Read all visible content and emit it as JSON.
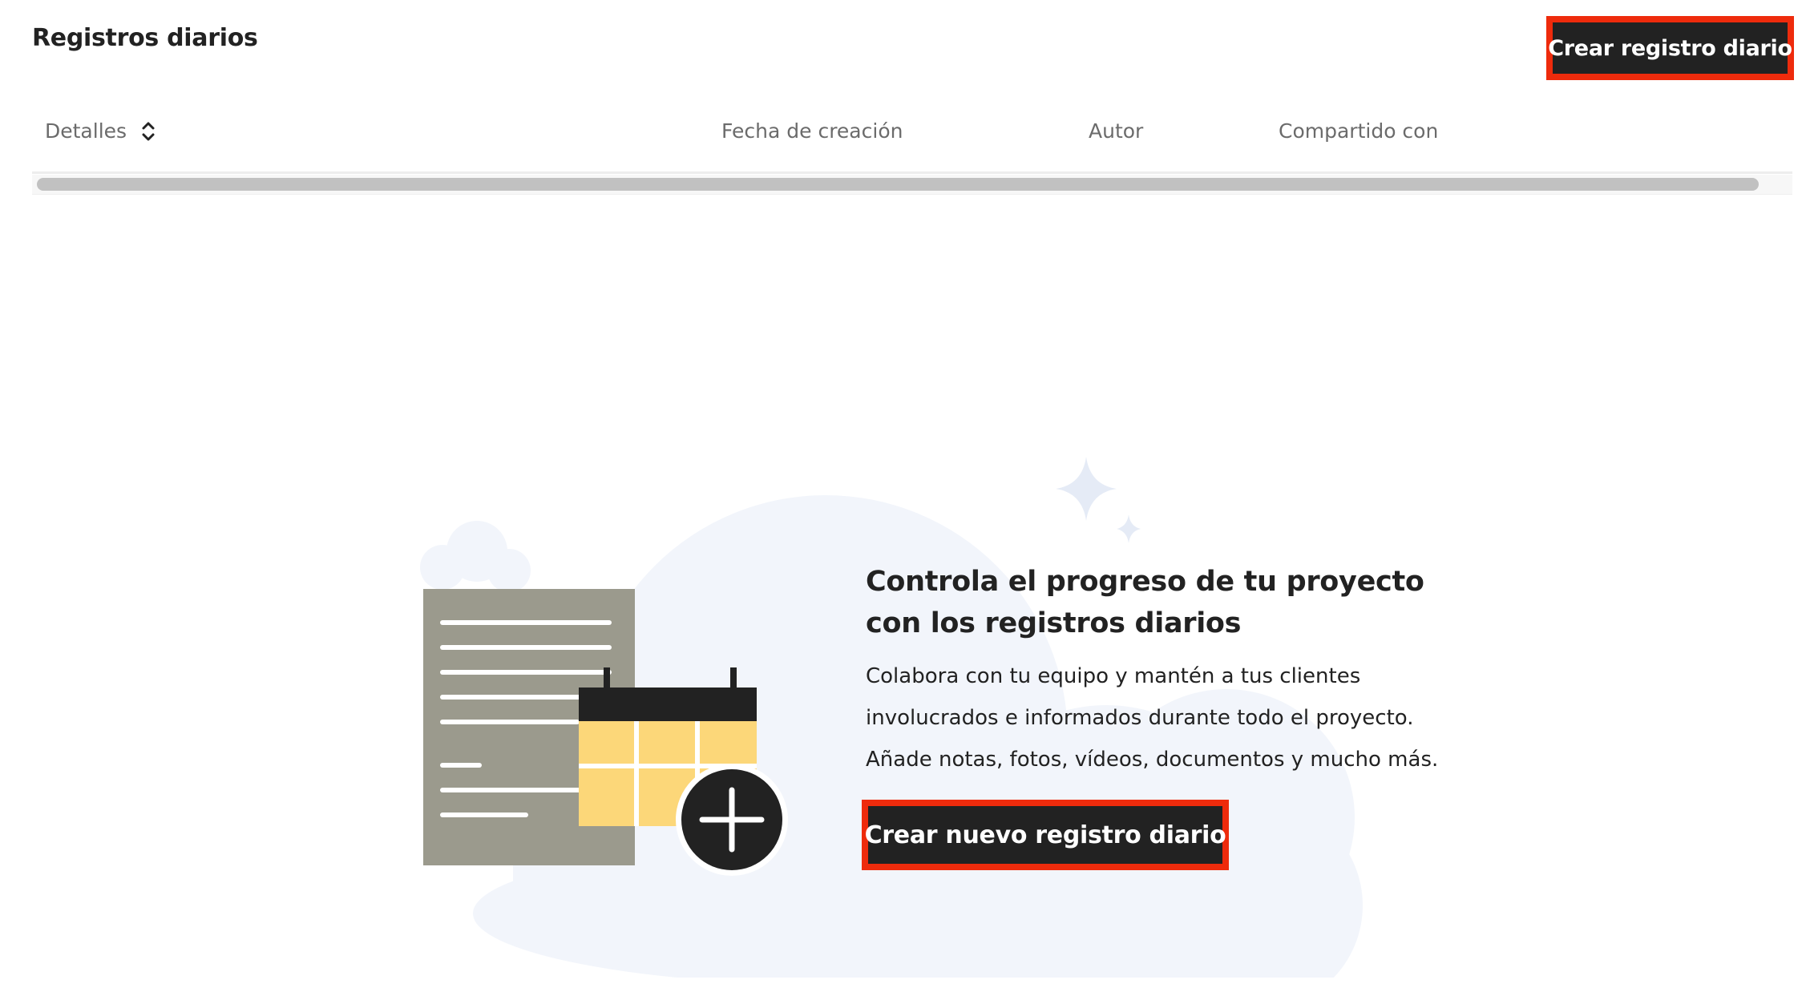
{
  "header": {
    "title": "Registros diarios",
    "create_button_label": "Crear registro diario"
  },
  "table": {
    "columns": [
      {
        "label": "Detalles",
        "sortable": true
      },
      {
        "label": "Fecha de creación"
      },
      {
        "label": "Autor"
      },
      {
        "label": "Compartido con"
      }
    ],
    "rows": []
  },
  "empty_state": {
    "title": "Controla el progreso de tu proyecto con los registros diarios",
    "body_lines": [
      "Colabora con tu equipo y mantén a tus clientes",
      "involucrados e informados durante todo el proyecto.",
      "Añade notas, fotos, vídeos, documentos y mucho más."
    ],
    "button_label": "Crear nuevo registro diario",
    "illustration": "document-calendar-add-icon"
  },
  "colors": {
    "button_bg": "#222222",
    "highlight_outline": "#ee2b0c",
    "cloud": "#f2f5fb",
    "document": "#9b9a8d",
    "calendar_cells": "#fcd779"
  }
}
